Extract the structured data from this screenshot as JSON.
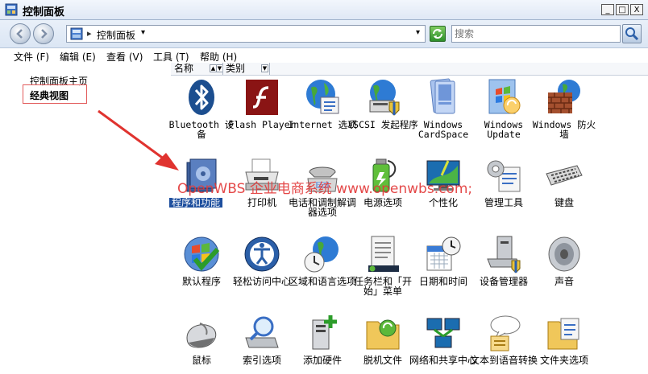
{
  "window": {
    "title": "控制面板"
  },
  "window_buttons": {
    "minimize": "_",
    "maximize": "□",
    "close": "X"
  },
  "address": {
    "path": "控制面板",
    "separator": "▸",
    "chevron": "▾",
    "dropdown": "▾"
  },
  "search": {
    "placeholder": "搜索"
  },
  "menu": [
    {
      "label": "文件 (F)"
    },
    {
      "label": "编辑 (E)"
    },
    {
      "label": "查看 (V)"
    },
    {
      "label": "工具 (T)"
    },
    {
      "label": "帮助 (H)"
    }
  ],
  "sidebar": {
    "home": "控制面板主页",
    "classic": "经典视图"
  },
  "columns": {
    "name": "名称",
    "category": "类别"
  },
  "items": [
    {
      "label": "Bluetooth 设备",
      "icon": "bluetooth-icon"
    },
    {
      "label": "Flash Player",
      "icon": "flash-icon"
    },
    {
      "label": "Internet 选项",
      "icon": "internet-globe-icon"
    },
    {
      "label": "iSCSI 发起程序",
      "icon": "iscsi-globe-icon"
    },
    {
      "label": "Windows CardSpace",
      "icon": "cardspace-icon"
    },
    {
      "label": "Windows Update",
      "icon": "windows-update-icon"
    },
    {
      "label": "Windows 防火墙",
      "icon": "firewall-icon"
    },
    {
      "label": "程序和功能",
      "icon": "programs-icon"
    },
    {
      "label": "打印机",
      "icon": "printer-icon"
    },
    {
      "label": "电话和调制解调器选项",
      "icon": "phone-modem-icon"
    },
    {
      "label": "电源选项",
      "icon": "power-icon"
    },
    {
      "label": "个性化",
      "icon": "personalization-icon"
    },
    {
      "label": "管理工具",
      "icon": "admin-tools-icon"
    },
    {
      "label": "键盘",
      "icon": "keyboard-icon"
    },
    {
      "label": "默认程序",
      "icon": "default-programs-icon"
    },
    {
      "label": "轻松访问中心",
      "icon": "ease-of-access-icon"
    },
    {
      "label": "区域和语言选项",
      "icon": "region-language-icon"
    },
    {
      "label": "任务栏和「开始」菜单",
      "icon": "taskbar-icon"
    },
    {
      "label": "日期和时间",
      "icon": "date-time-icon"
    },
    {
      "label": "设备管理器",
      "icon": "device-manager-icon"
    },
    {
      "label": "声音",
      "icon": "sound-icon"
    },
    {
      "label": "鼠标",
      "icon": "mouse-icon"
    },
    {
      "label": "索引选项",
      "icon": "indexing-icon"
    },
    {
      "label": "添加硬件",
      "icon": "add-hardware-icon"
    },
    {
      "label": "脱机文件",
      "icon": "offline-files-icon"
    },
    {
      "label": "网络和共享中心",
      "icon": "network-icon"
    },
    {
      "label": "文本到语音转换",
      "icon": "text-to-speech-icon"
    },
    {
      "label": "文件夹选项",
      "icon": "folder-options-icon"
    }
  ],
  "watermark": "OpenWBS 企业电商系统 www.openwbs.com;"
}
